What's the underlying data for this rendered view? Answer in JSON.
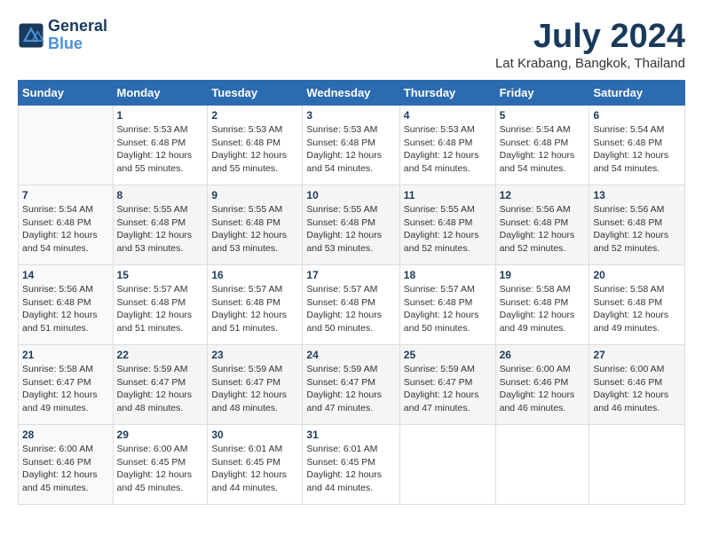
{
  "header": {
    "logo_line1": "General",
    "logo_line2": "Blue",
    "month": "July 2024",
    "location": "Lat Krabang, Bangkok, Thailand"
  },
  "weekdays": [
    "Sunday",
    "Monday",
    "Tuesday",
    "Wednesday",
    "Thursday",
    "Friday",
    "Saturday"
  ],
  "weeks": [
    [
      {
        "day": "",
        "info": ""
      },
      {
        "day": "1",
        "info": "Sunrise: 5:53 AM\nSunset: 6:48 PM\nDaylight: 12 hours\nand 55 minutes."
      },
      {
        "day": "2",
        "info": "Sunrise: 5:53 AM\nSunset: 6:48 PM\nDaylight: 12 hours\nand 55 minutes."
      },
      {
        "day": "3",
        "info": "Sunrise: 5:53 AM\nSunset: 6:48 PM\nDaylight: 12 hours\nand 54 minutes."
      },
      {
        "day": "4",
        "info": "Sunrise: 5:53 AM\nSunset: 6:48 PM\nDaylight: 12 hours\nand 54 minutes."
      },
      {
        "day": "5",
        "info": "Sunrise: 5:54 AM\nSunset: 6:48 PM\nDaylight: 12 hours\nand 54 minutes."
      },
      {
        "day": "6",
        "info": "Sunrise: 5:54 AM\nSunset: 6:48 PM\nDaylight: 12 hours\nand 54 minutes."
      }
    ],
    [
      {
        "day": "7",
        "info": "Sunrise: 5:54 AM\nSunset: 6:48 PM\nDaylight: 12 hours\nand 54 minutes."
      },
      {
        "day": "8",
        "info": "Sunrise: 5:55 AM\nSunset: 6:48 PM\nDaylight: 12 hours\nand 53 minutes."
      },
      {
        "day": "9",
        "info": "Sunrise: 5:55 AM\nSunset: 6:48 PM\nDaylight: 12 hours\nand 53 minutes."
      },
      {
        "day": "10",
        "info": "Sunrise: 5:55 AM\nSunset: 6:48 PM\nDaylight: 12 hours\nand 53 minutes."
      },
      {
        "day": "11",
        "info": "Sunrise: 5:55 AM\nSunset: 6:48 PM\nDaylight: 12 hours\nand 52 minutes."
      },
      {
        "day": "12",
        "info": "Sunrise: 5:56 AM\nSunset: 6:48 PM\nDaylight: 12 hours\nand 52 minutes."
      },
      {
        "day": "13",
        "info": "Sunrise: 5:56 AM\nSunset: 6:48 PM\nDaylight: 12 hours\nand 52 minutes."
      }
    ],
    [
      {
        "day": "14",
        "info": "Sunrise: 5:56 AM\nSunset: 6:48 PM\nDaylight: 12 hours\nand 51 minutes."
      },
      {
        "day": "15",
        "info": "Sunrise: 5:57 AM\nSunset: 6:48 PM\nDaylight: 12 hours\nand 51 minutes."
      },
      {
        "day": "16",
        "info": "Sunrise: 5:57 AM\nSunset: 6:48 PM\nDaylight: 12 hours\nand 51 minutes."
      },
      {
        "day": "17",
        "info": "Sunrise: 5:57 AM\nSunset: 6:48 PM\nDaylight: 12 hours\nand 50 minutes."
      },
      {
        "day": "18",
        "info": "Sunrise: 5:57 AM\nSunset: 6:48 PM\nDaylight: 12 hours\nand 50 minutes."
      },
      {
        "day": "19",
        "info": "Sunrise: 5:58 AM\nSunset: 6:48 PM\nDaylight: 12 hours\nand 49 minutes."
      },
      {
        "day": "20",
        "info": "Sunrise: 5:58 AM\nSunset: 6:48 PM\nDaylight: 12 hours\nand 49 minutes."
      }
    ],
    [
      {
        "day": "21",
        "info": "Sunrise: 5:58 AM\nSunset: 6:47 PM\nDaylight: 12 hours\nand 49 minutes."
      },
      {
        "day": "22",
        "info": "Sunrise: 5:59 AM\nSunset: 6:47 PM\nDaylight: 12 hours\nand 48 minutes."
      },
      {
        "day": "23",
        "info": "Sunrise: 5:59 AM\nSunset: 6:47 PM\nDaylight: 12 hours\nand 48 minutes."
      },
      {
        "day": "24",
        "info": "Sunrise: 5:59 AM\nSunset: 6:47 PM\nDaylight: 12 hours\nand 47 minutes."
      },
      {
        "day": "25",
        "info": "Sunrise: 5:59 AM\nSunset: 6:47 PM\nDaylight: 12 hours\nand 47 minutes."
      },
      {
        "day": "26",
        "info": "Sunrise: 6:00 AM\nSunset: 6:46 PM\nDaylight: 12 hours\nand 46 minutes."
      },
      {
        "day": "27",
        "info": "Sunrise: 6:00 AM\nSunset: 6:46 PM\nDaylight: 12 hours\nand 46 minutes."
      }
    ],
    [
      {
        "day": "28",
        "info": "Sunrise: 6:00 AM\nSunset: 6:46 PM\nDaylight: 12 hours\nand 45 minutes."
      },
      {
        "day": "29",
        "info": "Sunrise: 6:00 AM\nSunset: 6:45 PM\nDaylight: 12 hours\nand 45 minutes."
      },
      {
        "day": "30",
        "info": "Sunrise: 6:01 AM\nSunset: 6:45 PM\nDaylight: 12 hours\nand 44 minutes."
      },
      {
        "day": "31",
        "info": "Sunrise: 6:01 AM\nSunset: 6:45 PM\nDaylight: 12 hours\nand 44 minutes."
      },
      {
        "day": "",
        "info": ""
      },
      {
        "day": "",
        "info": ""
      },
      {
        "day": "",
        "info": ""
      }
    ]
  ]
}
